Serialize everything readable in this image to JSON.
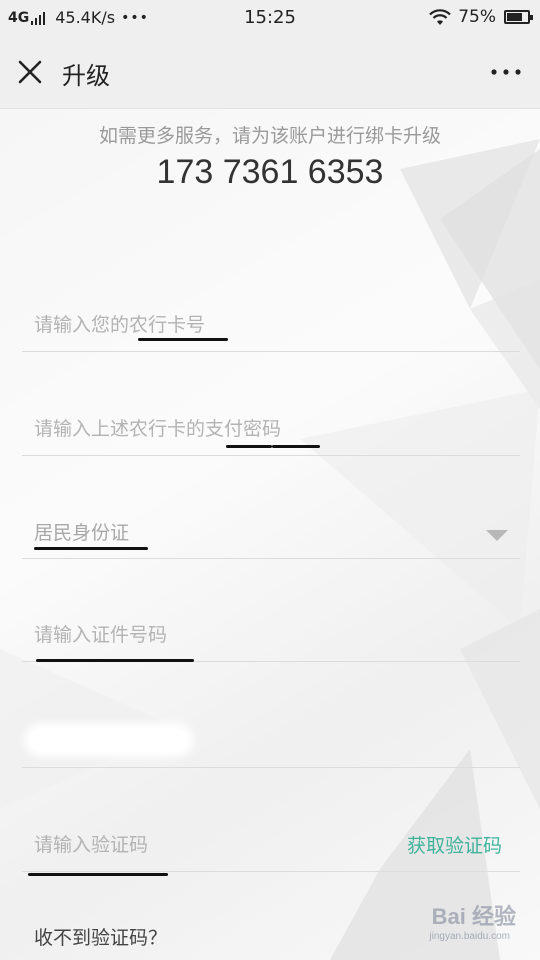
{
  "status_bar": {
    "network": "4G",
    "speed": "45.4K/s",
    "more": "•••",
    "time": "15:25",
    "battery": "75%",
    "battery_level": 0.75
  },
  "nav": {
    "title": "升级"
  },
  "main": {
    "prompt": "如需更多服务，请为该账户进行绑卡升级",
    "account_number": "173 7361 6353",
    "card_field": {
      "placeholder": "请输入您的农行卡号",
      "value": ""
    },
    "password_field": {
      "placeholder": "请输入上述农行卡的支付密码",
      "value": ""
    },
    "id_type_select": {
      "selected": "居民身份证"
    },
    "id_number_field": {
      "placeholder": "请输入证件号码",
      "value": ""
    },
    "code_field": {
      "placeholder": "请输入验证码",
      "value": ""
    },
    "get_code_label": "获取验证码",
    "no_code_label": "收不到验证码？"
  },
  "watermark": {
    "brand": "Bai  经验",
    "sub": "jingyan.baidu.com"
  },
  "colors": {
    "accent": "#3fb39b",
    "background": "#f6f6f6",
    "text": "#333333",
    "placeholder": "#b3b3b3"
  },
  "icons": [
    "close-icon",
    "more-icon",
    "wifi-icon",
    "battery-icon",
    "signal-icon",
    "dropdown-arrow-icon"
  ]
}
